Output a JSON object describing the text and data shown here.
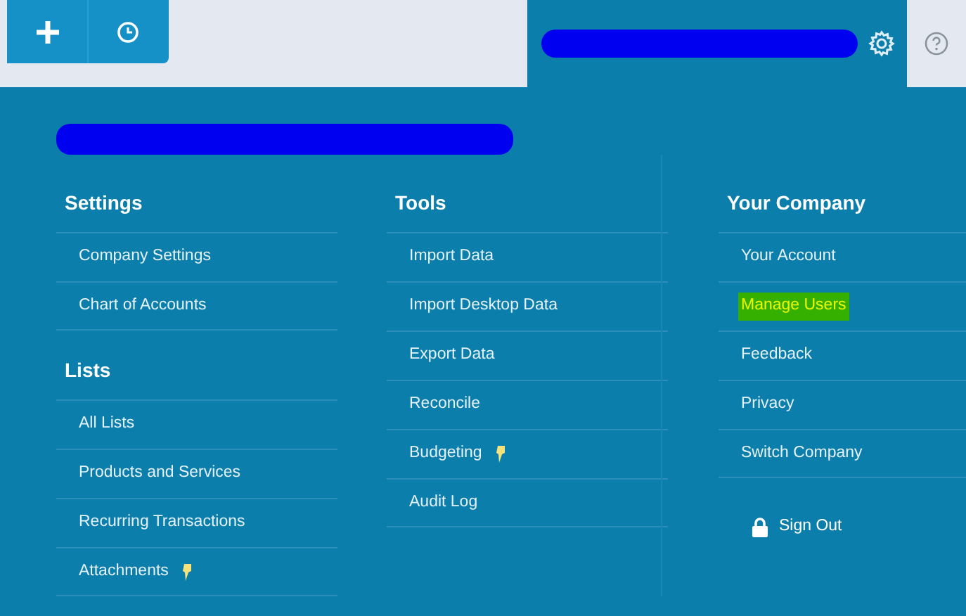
{
  "toolbar": {
    "buttons": [
      {
        "kind": "plus"
      },
      {
        "kind": "clock"
      }
    ]
  },
  "account_tab": {
    "selected": true,
    "redacted": true
  },
  "panel": {
    "redacted": true,
    "columns": [
      {
        "sections": [
          {
            "heading": "Settings",
            "items": [
              {
                "label": "Company Settings",
                "highlighted": false,
                "pinned": false
              },
              {
                "label": "Chart of Accounts",
                "highlighted": false,
                "pinned": false
              }
            ]
          },
          {
            "heading": "Lists",
            "items": [
              {
                "label": "All Lists",
                "highlighted": false,
                "pinned": false
              },
              {
                "label": "Products and Services",
                "highlighted": false,
                "pinned": false
              },
              {
                "label": "Recurring Transactions",
                "highlighted": false,
                "pinned": false
              },
              {
                "label": "Attachments",
                "highlighted": false,
                "pinned": true
              }
            ]
          }
        ]
      },
      {
        "sections": [
          {
            "heading": "Tools",
            "items": [
              {
                "label": "Import Data",
                "highlighted": false,
                "pinned": false
              },
              {
                "label": "Import Desktop Data",
                "highlighted": false,
                "pinned": false
              },
              {
                "label": "Export Data",
                "highlighted": false,
                "pinned": false
              },
              {
                "label": "Reconcile",
                "highlighted": false,
                "pinned": false
              },
              {
                "label": "Budgeting",
                "highlighted": false,
                "pinned": true
              },
              {
                "label": "Audit Log",
                "highlighted": false,
                "pinned": false
              }
            ]
          }
        ]
      },
      {
        "sections": [
          {
            "heading": "Your Company",
            "items": [
              {
                "label": "Your Account",
                "highlighted": false,
                "pinned": false
              },
              {
                "label": "Manage Users",
                "highlighted": true,
                "pinned": false
              },
              {
                "label": "Feedback",
                "highlighted": false,
                "pinned": false
              },
              {
                "label": "Privacy",
                "highlighted": false,
                "pinned": false
              },
              {
                "label": "Switch Company",
                "highlighted": false,
                "pinned": false
              }
            ]
          }
        ],
        "sign_out": "Sign Out"
      }
    ]
  }
}
